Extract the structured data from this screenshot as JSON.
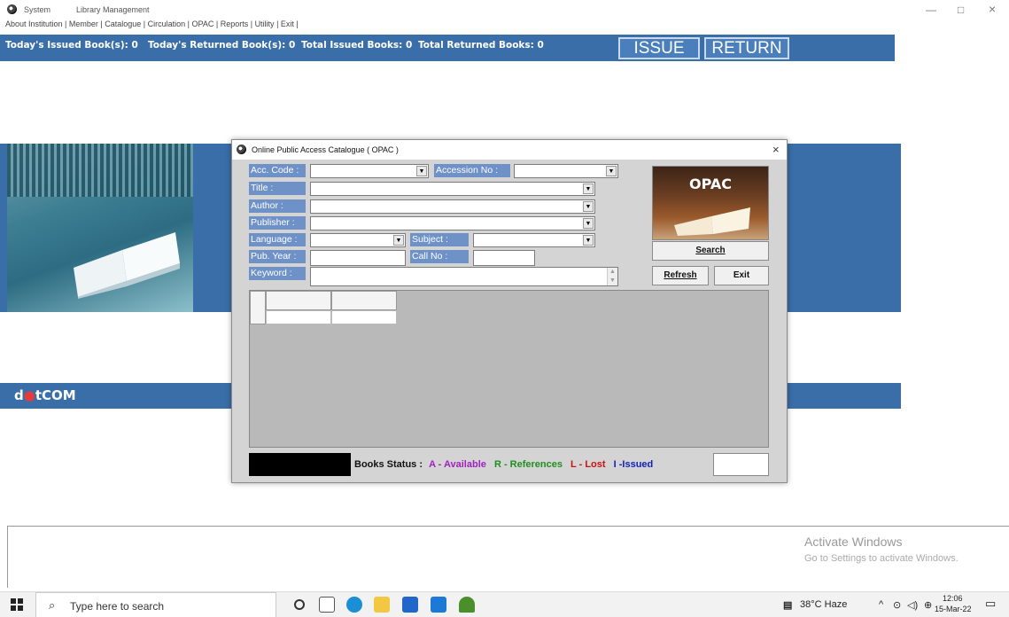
{
  "window": {
    "title_left": "System",
    "title_right": "Library Management",
    "minimize": "—",
    "maximize": "□",
    "close": "×"
  },
  "menu": [
    "About Institution",
    "Member",
    "Catalogue",
    "Circulation",
    "OPAC",
    "Reports",
    "Utility",
    "Exit"
  ],
  "status": {
    "todays_issued": "Today's Issued Book(s): 0",
    "todays_returned": "Today's Returned Book(s): 0",
    "total_issued": "Total Issued Books: 0",
    "total_returned": "Total Returned Books: 0",
    "issue_button": "ISSUE",
    "return_button": "RETURN"
  },
  "logo": {
    "part1": "d",
    "part2": "t",
    "part3": "COM"
  },
  "activate": {
    "line1": "Activate Windows",
    "line2": "Go to Settings to activate Windows."
  },
  "dialog": {
    "title": "Online Public Access Catalogue ( OPAC )",
    "close": "×",
    "labels": {
      "acc_code": "Acc. Code :",
      "accession_no": "Accession No :",
      "title": "Title :",
      "author": "Author :",
      "publisher": "Publisher :",
      "language": "Language :",
      "subject": "Subject :",
      "pub_year": "Pub. Year :",
      "call_no": "Call No :",
      "keyword": "Keyword :"
    },
    "opac_image_text": "OPAC",
    "search_button": "Search",
    "refresh_button": "Refresh",
    "exit_button": "Exit",
    "books_status": {
      "label": "Books Status :",
      "a": "A - Available",
      "r": "R - References",
      "l": "L - Lost",
      "i": "I -Issued",
      "colors": {
        "a": "#a020c0",
        "r": "#1e8f1e",
        "l": "#d01010",
        "i": "#1020c0"
      }
    }
  },
  "taskbar": {
    "search_placeholder": "Type here to search",
    "weather": "38°C  Haze",
    "time": "12:06",
    "date": "15-Mar-22"
  },
  "colors": {
    "accent_blue": "#3a6ea8",
    "label_blue": "#6e91c8"
  }
}
